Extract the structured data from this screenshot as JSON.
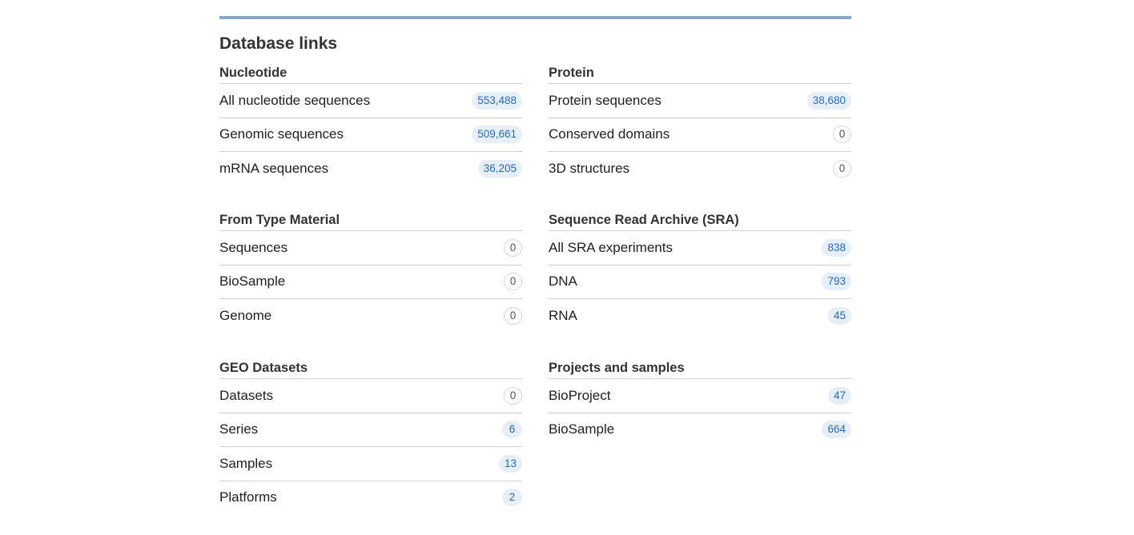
{
  "panel": {
    "title": "Database links"
  },
  "sections": [
    {
      "key": "nucleotide",
      "title": "Nucleotide",
      "rows": [
        {
          "label": "All nucleotide sequences",
          "count": "553,488"
        },
        {
          "label": "Genomic sequences",
          "count": "509,661"
        },
        {
          "label": "mRNA sequences",
          "count": "36,205"
        }
      ]
    },
    {
      "key": "protein",
      "title": "Protein",
      "rows": [
        {
          "label": "Protein sequences",
          "count": "38,680"
        },
        {
          "label": "Conserved domains",
          "count": "0"
        },
        {
          "label": "3D structures",
          "count": "0"
        }
      ]
    },
    {
      "key": "type-material",
      "title": "From Type Material",
      "rows": [
        {
          "label": "Sequences",
          "count": "0"
        },
        {
          "label": "BioSample",
          "count": "0"
        },
        {
          "label": "Genome",
          "count": "0"
        }
      ]
    },
    {
      "key": "sra",
      "title": "Sequence Read Archive (SRA)",
      "rows": [
        {
          "label": "All SRA experiments",
          "count": "838"
        },
        {
          "label": "DNA",
          "count": "793"
        },
        {
          "label": "RNA",
          "count": "45"
        }
      ]
    },
    {
      "key": "geo",
      "title": "GEO Datasets",
      "rows": [
        {
          "label": "Datasets",
          "count": "0"
        },
        {
          "label": "Series",
          "count": "6"
        },
        {
          "label": "Samples",
          "count": "13"
        },
        {
          "label": "Platforms",
          "count": "2"
        }
      ]
    },
    {
      "key": "projects",
      "title": "Projects and samples",
      "rows": [
        {
          "label": "BioProject",
          "count": "47"
        },
        {
          "label": "BioSample",
          "count": "664"
        }
      ]
    }
  ],
  "colors": {
    "rule": "#8aa6c8",
    "badge_bg": "#e6eef8",
    "badge_text": "#2b6bb5"
  }
}
